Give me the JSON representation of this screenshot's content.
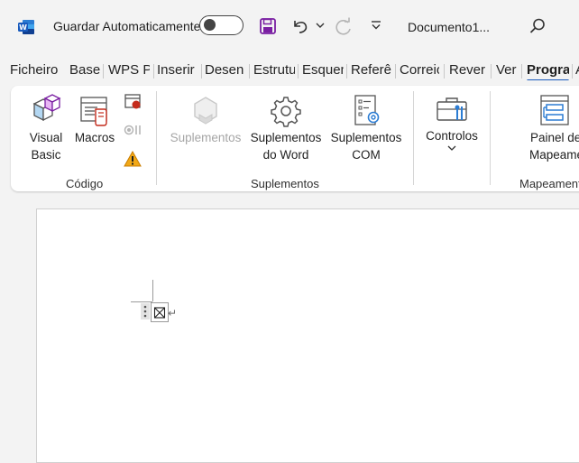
{
  "titlebar": {
    "autosave_label": "Guardar Automaticamente",
    "document_title": "Documento1...",
    "icons": [
      "word-logo-icon",
      "save-icon",
      "undo-icon",
      "chevron-down-icon",
      "redo-icon",
      "customize-qat-icon",
      "search-icon"
    ],
    "brand_color": "#185abd"
  },
  "tabs": [
    {
      "label": "Ficheiro"
    },
    {
      "label": "Base"
    },
    {
      "label": "WPS PDF"
    },
    {
      "label": "Inserir"
    },
    {
      "label": "Desenhar"
    },
    {
      "label": "Estrutura"
    },
    {
      "label": "Esquema"
    },
    {
      "label": "Referências"
    },
    {
      "label": "Correio"
    },
    {
      "label": "Rever"
    },
    {
      "label": "Ver"
    },
    {
      "label": "Programador"
    },
    {
      "label": "Ajuda"
    }
  ],
  "ribbon": {
    "groups": {
      "codigo": "Código",
      "suplementos": "Suplementos",
      "mapeamento": "Mapeamento"
    },
    "buttons": {
      "visual_basic": [
        "Visual",
        "Basic"
      ],
      "macros": "Macros",
      "suplementos": "Suplementos",
      "suplementos_word": [
        "Suplementos",
        "do Word"
      ],
      "suplementos_com": [
        "Suplementos",
        "COM"
      ],
      "controlos": "Controlos",
      "painel_mapeamento": [
        "Painel de",
        "Mapeamento"
      ]
    }
  },
  "document": {
    "paragraph_mark": "↵",
    "control_glyph": "⊠"
  }
}
